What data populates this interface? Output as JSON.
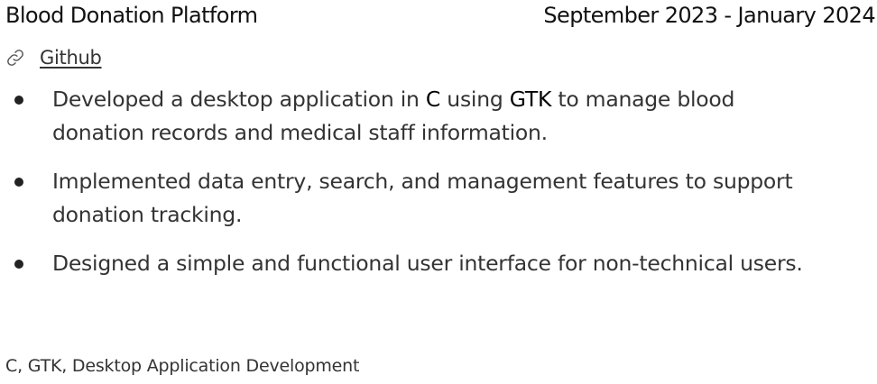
{
  "project": {
    "title": "Blood Donation Platform",
    "dates": "September 2023 - January 2024"
  },
  "link": {
    "icon": "link-icon",
    "label": "Github"
  },
  "bullets": [
    {
      "parts": [
        {
          "text": "Developed a desktop application in ",
          "strong": false
        },
        {
          "text": "C",
          "strong": true
        },
        {
          "text": " using ",
          "strong": false
        },
        {
          "text": "GTK",
          "strong": true
        },
        {
          "text": " to manage blood donation records and medical staff information.",
          "strong": false
        }
      ]
    },
    {
      "parts": [
        {
          "text": "Implemented data entry, search, and management features to support donation tracking.",
          "strong": false
        }
      ]
    },
    {
      "parts": [
        {
          "text": "Designed a simple and functional user interface for non-technical users.",
          "strong": false
        }
      ]
    }
  ],
  "skills": "C, GTK, Desktop Application Development"
}
